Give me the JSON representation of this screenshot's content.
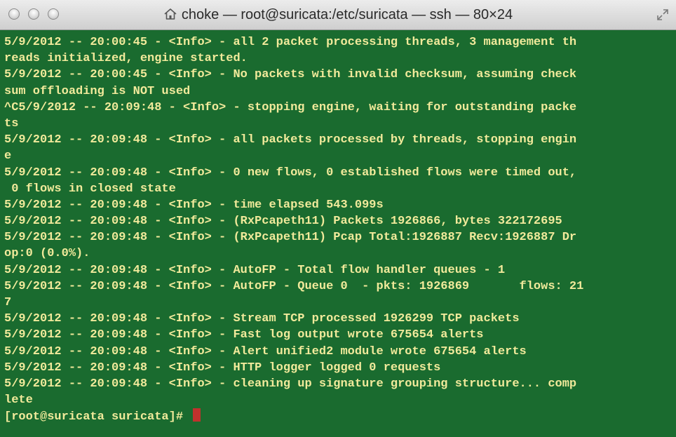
{
  "window": {
    "title": "choke — root@suricata:/etc/suricata — ssh — 80×24",
    "title_icon": "home-icon",
    "controls": [
      "close",
      "minimize",
      "zoom"
    ],
    "fullscreen_icon": "fullscreen-icon"
  },
  "colors": {
    "terminal_background": "#1a6b2f",
    "terminal_text": "#f1ea9b",
    "cursor": "#c0322d"
  },
  "terminal": {
    "lines": [
      "5/9/2012 -- 20:00:45 - <Info> - all 2 packet processing threads, 3 management th",
      "reads initialized, engine started.",
      "5/9/2012 -- 20:00:45 - <Info> - No packets with invalid checksum, assuming check",
      "sum offloading is NOT used",
      "^C5/9/2012 -- 20:09:48 - <Info> - stopping engine, waiting for outstanding packe",
      "ts",
      "5/9/2012 -- 20:09:48 - <Info> - all packets processed by threads, stopping engin",
      "e",
      "5/9/2012 -- 20:09:48 - <Info> - 0 new flows, 0 established flows were timed out,",
      " 0 flows in closed state",
      "5/9/2012 -- 20:09:48 - <Info> - time elapsed 543.099s",
      "5/9/2012 -- 20:09:48 - <Info> - (RxPcapeth11) Packets 1926866, bytes 322172695",
      "5/9/2012 -- 20:09:48 - <Info> - (RxPcapeth11) Pcap Total:1926887 Recv:1926887 Dr",
      "op:0 (0.0%).",
      "5/9/2012 -- 20:09:48 - <Info> - AutoFP - Total flow handler queues - 1",
      "5/9/2012 -- 20:09:48 - <Info> - AutoFP - Queue 0  - pkts: 1926869       flows: 21",
      "7",
      "5/9/2012 -- 20:09:48 - <Info> - Stream TCP processed 1926299 TCP packets",
      "5/9/2012 -- 20:09:48 - <Info> - Fast log output wrote 675654 alerts",
      "5/9/2012 -- 20:09:48 - <Info> - Alert unified2 module wrote 675654 alerts",
      "5/9/2012 -- 20:09:48 - <Info> - HTTP logger logged 0 requests",
      "5/9/2012 -- 20:09:48 - <Info> - cleaning up signature grouping structure... comp",
      "lete"
    ],
    "prompt": "[root@suricata suricata]# "
  }
}
